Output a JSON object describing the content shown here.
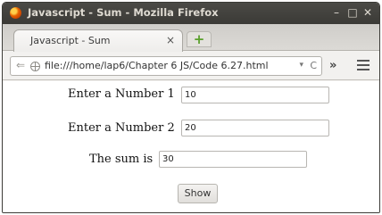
{
  "window": {
    "title": "Javascript - Sum - Mozilla Firefox",
    "minimize": "–",
    "maximize": "□",
    "close": "✕"
  },
  "tabs": [
    {
      "label": "Javascript - Sum",
      "close": "×"
    }
  ],
  "new_tab_label": "+",
  "navbar": {
    "back": "⇐",
    "url": "file:///home/lap6/Chapter 6 JS/Code 6.27.html",
    "url_dropdown": "▾",
    "reload": "C",
    "overflow": "»"
  },
  "form": {
    "label1": "Enter a Number 1",
    "value1": "10",
    "label2": "Enter a Number 2",
    "value2": "20",
    "label3": "The sum is",
    "value3": "30",
    "button": "Show"
  }
}
